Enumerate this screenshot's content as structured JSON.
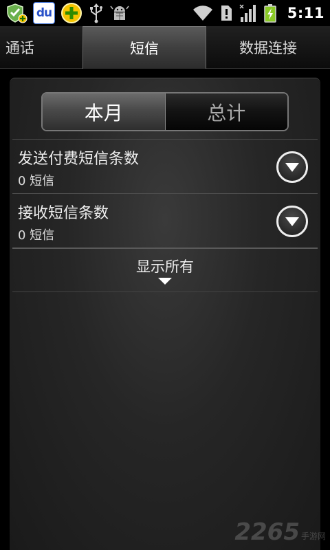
{
  "statusbar": {
    "left_icons": [
      "security-shield-icon",
      "baidu-icon",
      "plus-circle-icon",
      "usb-icon",
      "android-debug-icon"
    ],
    "baidu_label": "du",
    "right_icons": [
      "wifi-icon",
      "alert-icon",
      "signal-icon",
      "battery-charging-icon"
    ],
    "time": "5:11"
  },
  "tabs": [
    {
      "label": "通话",
      "active": false
    },
    {
      "label": "短信",
      "active": true
    },
    {
      "label": "数据连接",
      "active": false
    }
  ],
  "segment": {
    "month_label": "本月",
    "total_label": "总计",
    "selected": "本月"
  },
  "rows": [
    {
      "title": "发送付费短信条数",
      "value": "0 短信"
    },
    {
      "title": "接收短信条数",
      "value": "0 短信"
    }
  ],
  "show_all_label": "显示所有",
  "watermark": {
    "number": "2265",
    "text": "手游网"
  },
  "colors": {
    "background": "#000000",
    "panel": "#262626",
    "active_tab": "#4a4a4a",
    "text": "#ffffff"
  }
}
